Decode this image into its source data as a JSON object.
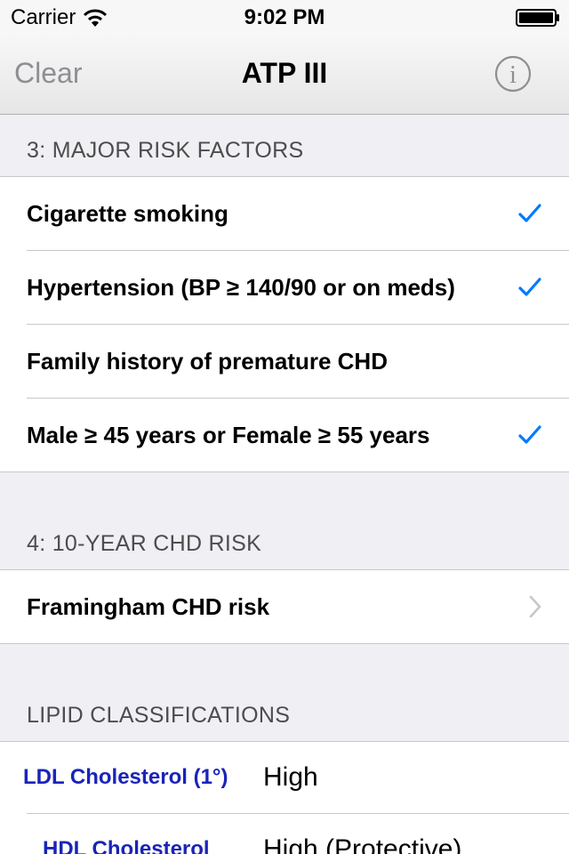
{
  "status_bar": {
    "carrier": "Carrier",
    "time": "9:02 PM"
  },
  "nav": {
    "left_label": "Clear",
    "title": "ATP III",
    "right_icon": "info-icon"
  },
  "colors": {
    "accent_blue": "#007aff",
    "lipid_blue": "#1a24b8",
    "nav_gray": "#8e8e93"
  },
  "sections": {
    "risk_factors": {
      "header": "3: MAJOR RISK FACTORS",
      "items": [
        {
          "label": "Cigarette smoking",
          "checked": true
        },
        {
          "label": "Hypertension (BP ≥ 140/90 or on meds)",
          "checked": true
        },
        {
          "label": "Family history of premature CHD",
          "checked": false
        },
        {
          "label": "Male ≥ 45 years or Female ≥ 55 years",
          "checked": true
        }
      ]
    },
    "chd_risk": {
      "header": "4: 10-YEAR CHD RISK",
      "items": [
        {
          "label": "Framingham CHD risk",
          "accessory": "chevron-right-icon"
        }
      ]
    },
    "lipids": {
      "header": "LIPID CLASSIFICATIONS",
      "items": [
        {
          "name": "LDL Cholesterol (1°)",
          "value": "High"
        },
        {
          "name": "HDL Cholesterol",
          "value": "High (Protective)"
        }
      ]
    }
  }
}
